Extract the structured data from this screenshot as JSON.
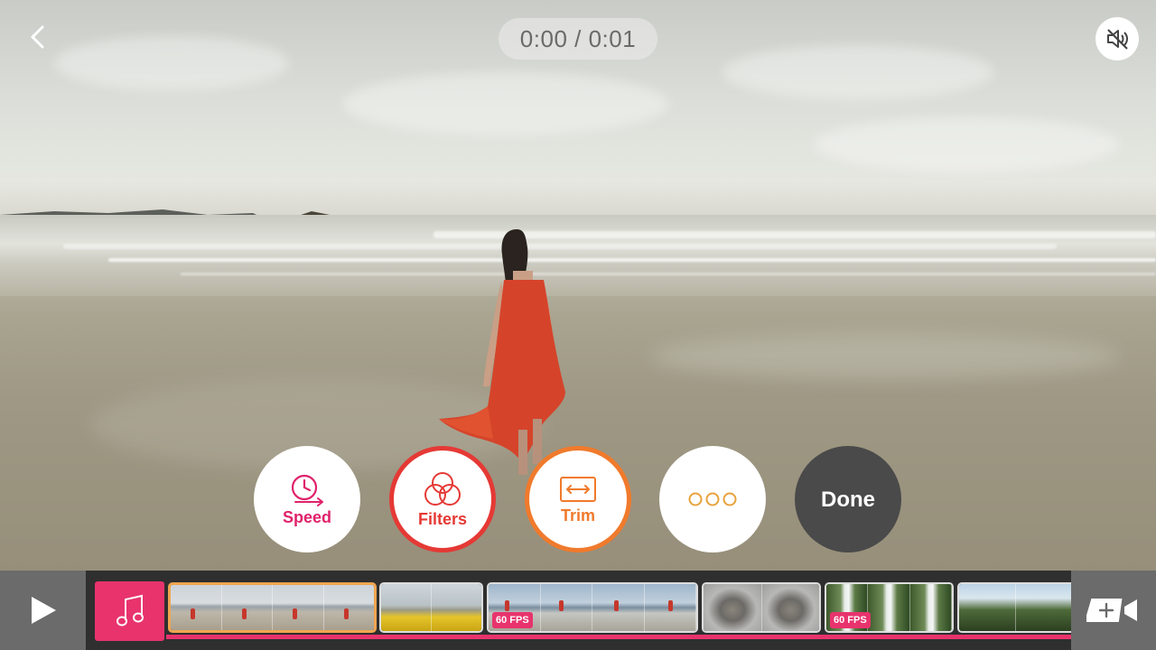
{
  "header": {
    "timer_text": "0:00 / 0:01"
  },
  "icons": {
    "back": "chevron-left-icon",
    "mute": "speaker-muted-icon",
    "play": "play-icon",
    "music": "music-note-icon",
    "add_video": "video-camera-plus-icon"
  },
  "actions": {
    "speed_label": "Speed",
    "filters_label": "Filters",
    "trim_label": "Trim",
    "done_label": "Done"
  },
  "colors": {
    "accent_pink": "#e8336d",
    "filters_red": "#e53935",
    "trim_orange": "#f07a2c",
    "done_gray": "#4a4a4a"
  },
  "timeline": {
    "clips": [
      {
        "id": 1,
        "badge": "",
        "selected": true
      },
      {
        "id": 2,
        "badge": ""
      },
      {
        "id": 3,
        "badge": "60 FPS"
      },
      {
        "id": 4,
        "badge": ""
      },
      {
        "id": 5,
        "badge": "60 FPS"
      },
      {
        "id": 6,
        "badge": ""
      }
    ]
  }
}
